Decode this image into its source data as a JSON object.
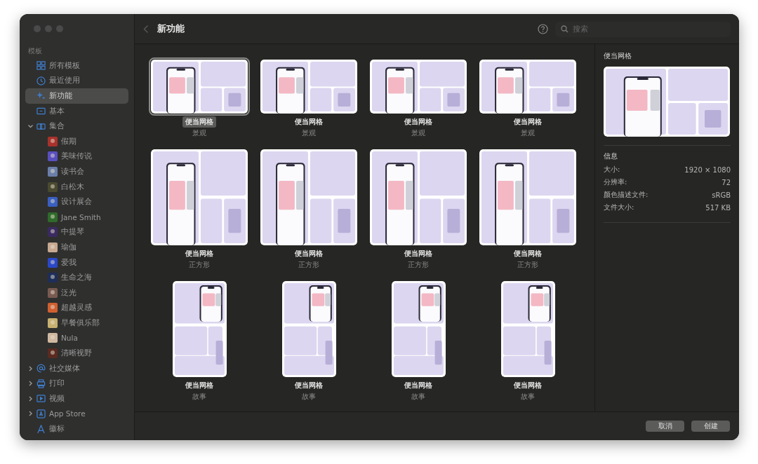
{
  "window": {
    "title": "新功能",
    "back_disabled": true
  },
  "search": {
    "placeholder": "搜索"
  },
  "sidebar": {
    "heading": "模板",
    "items": [
      {
        "label": "所有模板",
        "kind": "grid",
        "selected": false
      },
      {
        "label": "最近使用",
        "kind": "clock",
        "selected": false
      },
      {
        "label": "新功能",
        "kind": "sparkle",
        "selected": true
      },
      {
        "label": "基本",
        "kind": "frame",
        "selected": false
      },
      {
        "label": "集合",
        "kind": "collection",
        "selected": false,
        "expanded": true,
        "children": [
          {
            "label": "假期",
            "color": "#a8322c",
            "selected": false
          },
          {
            "label": "美味传说",
            "color": "#5a4fc0",
            "selected": false
          },
          {
            "label": "读书会",
            "color": "#6a7fa8",
            "selected": false
          },
          {
            "label": "白松木",
            "color": "#4a4a30",
            "selected": false
          },
          {
            "label": "设计展会",
            "color": "#3a5fc0",
            "selected": false
          },
          {
            "label": "Jane Smith",
            "color": "#2f6a2a",
            "selected": false
          },
          {
            "label": "中提琴",
            "color": "#3a2a60",
            "selected": false
          },
          {
            "label": "瑜伽",
            "color": "#c8a890",
            "selected": false
          },
          {
            "label": "爱我",
            "color": "#2a48c8",
            "selected": false
          },
          {
            "label": "生命之海",
            "color": "#1e2e5a",
            "selected": false
          },
          {
            "label": "泛光",
            "color": "#7a5a50",
            "selected": false
          },
          {
            "label": "超越灵感",
            "color": "#d06030",
            "selected": false
          },
          {
            "label": "早餐俱乐部",
            "color": "#c8b070",
            "selected": false
          },
          {
            "label": "Nula",
            "color": "#d0b8a0",
            "selected": false
          },
          {
            "label": "清晰视野",
            "color": "#5a2a20",
            "selected": false
          }
        ]
      },
      {
        "label": "社交媒体",
        "kind": "at",
        "selected": false,
        "expanded": false
      },
      {
        "label": "打印",
        "kind": "print",
        "selected": false,
        "expanded": false
      },
      {
        "label": "视频",
        "kind": "video",
        "selected": false,
        "expanded": false
      },
      {
        "label": "App Store",
        "kind": "appstore",
        "selected": false,
        "expanded": false
      },
      {
        "label": "徽标",
        "kind": "font",
        "selected": false
      }
    ]
  },
  "templates": [
    {
      "title": "便当网格",
      "subtitle": "景观",
      "kind": "landscape",
      "selected": true
    },
    {
      "title": "便当网格",
      "subtitle": "景观",
      "kind": "landscape",
      "selected": false
    },
    {
      "title": "便当网格",
      "subtitle": "景观",
      "kind": "landscape",
      "selected": false
    },
    {
      "title": "便当网格",
      "subtitle": "景观",
      "kind": "landscape",
      "selected": false
    },
    {
      "title": "便当网格",
      "subtitle": "正方形",
      "kind": "square",
      "selected": false
    },
    {
      "title": "便当网格",
      "subtitle": "正方形",
      "kind": "square",
      "selected": false
    },
    {
      "title": "便当网格",
      "subtitle": "正方形",
      "kind": "square",
      "selected": false
    },
    {
      "title": "便当网格",
      "subtitle": "正方形",
      "kind": "square",
      "selected": false
    },
    {
      "title": "便当网格",
      "subtitle": "故事",
      "kind": "portrait",
      "selected": false
    },
    {
      "title": "便当网格",
      "subtitle": "故事",
      "kind": "portrait",
      "selected": false
    },
    {
      "title": "便当网格",
      "subtitle": "故事",
      "kind": "portrait",
      "selected": false
    },
    {
      "title": "便当网格",
      "subtitle": "故事",
      "kind": "portrait",
      "selected": false
    }
  ],
  "details": {
    "title": "便当网格",
    "info_heading": "信息",
    "rows": [
      {
        "label": "大小:",
        "value": "1920 × 1080"
      },
      {
        "label": "分辨率:",
        "value": "72"
      },
      {
        "label": "颜色描述文件:",
        "value": "sRGB"
      },
      {
        "label": "文件大小:",
        "value": "517 KB"
      }
    ]
  },
  "buttons": [
    {
      "label": "取消"
    },
    {
      "label": "创建"
    }
  ]
}
